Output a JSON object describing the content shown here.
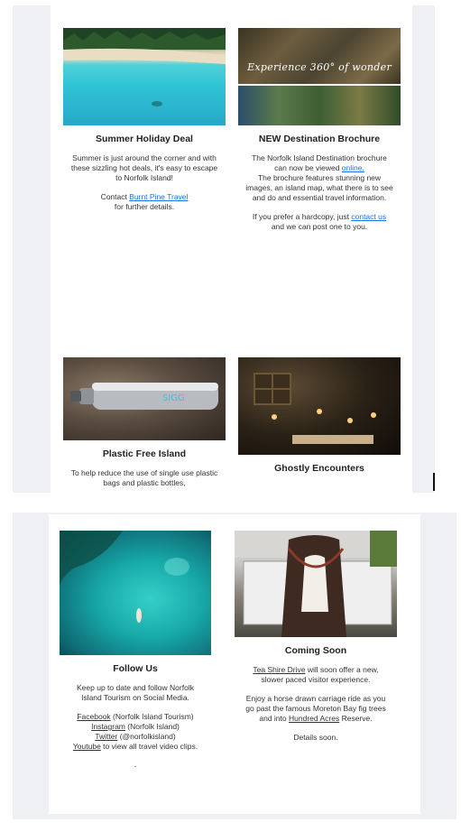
{
  "cards": {
    "summer": {
      "title": "Summer Holiday Deal",
      "body": "Summer is just around the corner and with these sizzling hot deals, it's easy to escape to Norfolk Island!",
      "contact_prefix": "Contact ",
      "contact_link": "Burnt Pine Travel",
      "contact_suffix": "for further details."
    },
    "brochure": {
      "overlay": "Experience 360° of wonder",
      "title": "NEW Destination Brochure",
      "body1_prefix": "The Norfolk Island Destination brochure can now be viewed ",
      "body1_link": "online.",
      "body2": "The brochure features stunning new images, an island map, what there is to see and do and essential travel information.",
      "body3_prefix": "If you prefer a hardcopy, just ",
      "body3_link": "contact us",
      "body3_suffix": "and we can post one to you."
    },
    "plastic": {
      "title": "Plastic Free Island",
      "body": "To help reduce the use of single use plastic bags and plastic bottles,"
    },
    "ghostly": {
      "title": "Ghostly Encounters"
    },
    "follow": {
      "title": "Follow Us",
      "intro": "Keep up to date and follow Norfolk Island Tourism on Social Media.",
      "facebook_link": "Facebook",
      "facebook_text": " (Norfolk Island Tourism)",
      "instagram_link": "Instagram",
      "instagram_text": " (Norfolk Island)",
      "twitter_link": "Twitter",
      "twitter_text": " (@norfolkisland)",
      "youtube_link": "Youtube",
      "youtube_text": " to view all travel video clips."
    },
    "coming": {
      "title": "Coming Soon",
      "body1_link": "Tea Shire Drive",
      "body1_text": " will soon offer a new, slower paced visitor experience.",
      "body2_prefix": "Enjoy a horse drawn carriage ride as you go past the famous Moreton Bay fig trees and into ",
      "body2_link": "Hundred Acres",
      "body2_suffix": " Reserve.",
      "body3": "Details soon."
    }
  },
  "bullet": "."
}
